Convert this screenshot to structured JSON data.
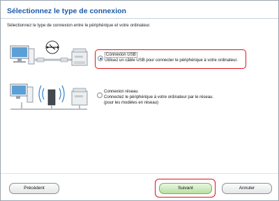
{
  "header": {
    "title": "Sélectionnez le type de connexion"
  },
  "instruction": "Sélectionnez le type de connexion entre le périphérique et votre ordinateur.",
  "options": [
    {
      "label": "Connexion USB",
      "description": "Utilisez un câble USB pour connecter le périphérique à votre ordinateur.",
      "selected": true
    },
    {
      "label": "Connexion réseau",
      "description_line1": "Connectez le périphérique à votre ordinateur par le réseau.",
      "description_line2": "(pour les modèles en réseau)",
      "selected": false
    }
  ],
  "buttons": {
    "previous": "Précédent",
    "next": "Suivant",
    "cancel": "Annuler"
  },
  "colors": {
    "title": "#1c5aa8",
    "highlight": "#e0121b",
    "next_button": "#b8e1a1"
  },
  "icons": [
    "computer-icon",
    "usb-icon",
    "printer-icon",
    "wifi-icon",
    "router-icon"
  ]
}
